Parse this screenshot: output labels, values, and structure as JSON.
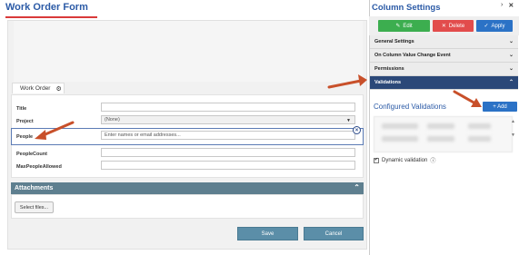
{
  "form": {
    "title": "Work Order Form",
    "tab_label": "Work Order",
    "fields": {
      "title_label": "Title",
      "project_label": "Project",
      "project_value": "(None)",
      "people_label": "People",
      "people_placeholder": "Enter names or email addresses...",
      "peoplecount_label": "PeopleCount",
      "maxpeople_label": "MaxPeopleAllowed"
    },
    "attachments_label": "Attachments",
    "select_files_label": "Select files...",
    "save_label": "Save",
    "cancel_label": "Cancel"
  },
  "settings": {
    "title": "Column Settings",
    "edit_label": "Edit",
    "delete_label": "Delete",
    "apply_label": "Apply",
    "sections": [
      "General Settings",
      "On Column Value Change Event",
      "Permissions",
      "Validations"
    ],
    "configured_title": "Configured Validations",
    "add_label": "+ Add",
    "dynamic_validation_label": "Dynamic validation"
  },
  "colors": {
    "accent_blue": "#2b5aa6",
    "edit_green": "#3cae4f",
    "delete_red": "#e24c4c",
    "apply_blue": "#2b72c6",
    "active_nav": "#2b4878",
    "arrow_red": "#c8502a"
  }
}
